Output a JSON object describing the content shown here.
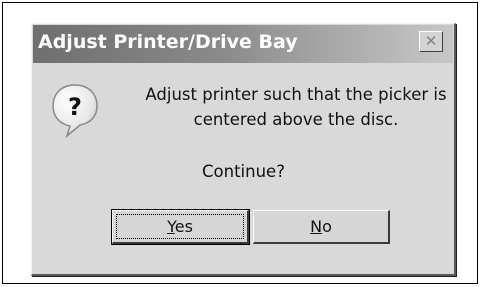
{
  "dialog": {
    "title": "Adjust Printer/Drive Bay",
    "close_glyph": "✕",
    "icon": "question-icon",
    "icon_glyph": "?",
    "message": "Adjust printer such that the picker is centered above the disc.",
    "prompt": "Continue?",
    "buttons": {
      "yes": {
        "first": "Y",
        "rest": "es"
      },
      "no": {
        "first": "N",
        "rest": "o"
      }
    }
  },
  "colors": {
    "dialog_bg": "#d9d9d9",
    "titlebar_start": "#6f6f6f",
    "titlebar_end": "#c8c8c8"
  }
}
